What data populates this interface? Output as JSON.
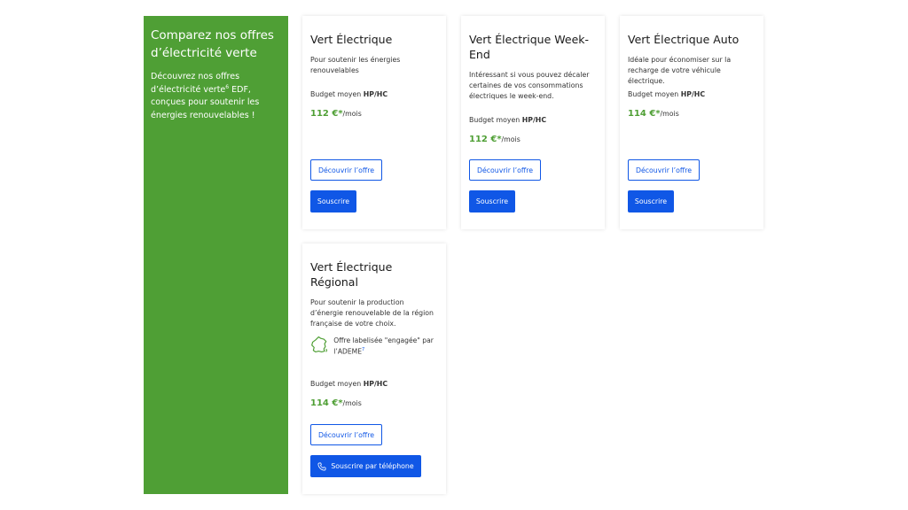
{
  "hero": {
    "title": "Comparez nos offres d’électricité verte",
    "desc_a": "Découvrez nos offres d’électricité verte",
    "desc_sup": "6",
    "desc_b": " EDF, conçues pour soutenir les énergies renouvelables !"
  },
  "offers": [
    {
      "title": "Vert Électrique",
      "desc": "Pour soutenir les énergies renouvelables",
      "budget_label": "Budget moyen ",
      "budget_bold": "HP/HC",
      "price": "112 €*",
      "price_unit": "/mois",
      "discover_label": "Découvrir l’offre",
      "subscribe_label": "Souscrire"
    },
    {
      "title": "Vert Électrique Week-End",
      "desc": "Intéressant si vous pouvez décaler certaines de vos consommations électriques le week-end.",
      "budget_label": "Budget moyen ",
      "budget_bold": "HP/HC",
      "price": "112 €*",
      "price_unit": "/mois",
      "discover_label": "Découvrir l’offre",
      "subscribe_label": "Souscrire"
    },
    {
      "title": "Vert Électrique Auto",
      "desc": "Idéale pour économiser sur la recharge de votre véhicule électrique.",
      "budget_label": "Budget moyen ",
      "budget_bold": "HP/HC",
      "price": "114 €*",
      "price_unit": "/mois",
      "discover_label": "Découvrir l’offre",
      "subscribe_label": "Souscrire"
    },
    {
      "title": "Vert Électrique Régional",
      "desc": "Pour soutenir la production d’énergie renouvelable de la région française de votre choix.",
      "label_text": "Offre labelisée \"engagée\" par l’ADEME",
      "label_sup": "7",
      "budget_label": "Budget moyen ",
      "budget_bold": "HP/HC",
      "price": "114 €*",
      "price_unit": "/mois",
      "discover_label": "Découvrir l’offre",
      "subscribe_label": "Souscrire par téléphone"
    }
  ],
  "colors": {
    "brand_green": "#4f9f35",
    "action_blue": "#1057e6"
  },
  "icons": {
    "label_icon": "france-map-icon",
    "phone_icon": "phone-icon"
  }
}
